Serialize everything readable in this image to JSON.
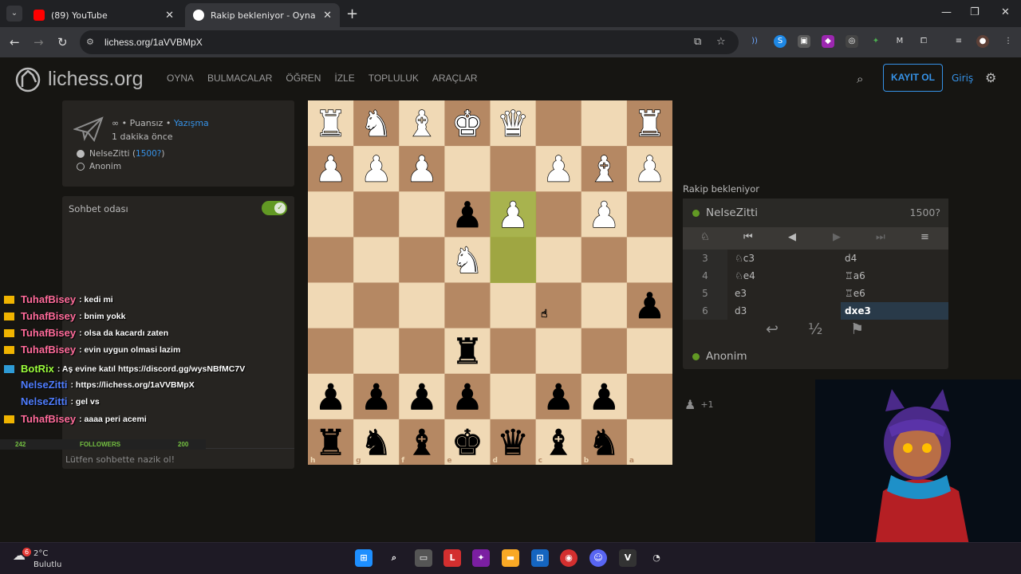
{
  "browser": {
    "tabs": [
      {
        "title": "(89) YouTube",
        "active": false
      },
      {
        "title": "Rakip bekleniyor - Oyna NelseZ",
        "active": true
      }
    ],
    "url": "lichess.org/1aVVBMpX"
  },
  "header": {
    "logo": "lichess.org",
    "nav": [
      "OYNA",
      "BULMACALAR",
      "ÖĞREN",
      "İZLE",
      "TOPLULUK",
      "ARAÇLAR"
    ],
    "signup": "KAYIT OL",
    "login": "Giriş"
  },
  "game_info": {
    "meta": "∞ • Puansız •",
    "mode": "Yazışma",
    "time_ago": "1 dakika önce",
    "player1_name": "NeIseZitti (",
    "player1_rating": "1500?",
    "player1_close": ")",
    "player2_name": "Anonim"
  },
  "chat": {
    "title": "Sohbet odası",
    "placeholder": "Lütfen sohbette nazik ol!"
  },
  "stream_chat": [
    {
      "user": "TuhafBisey",
      "text": ": kedi mi",
      "color": "#ff6b9a"
    },
    {
      "user": "TuhafBisey",
      "text": ": bnim yokk",
      "color": "#ff6b9a"
    },
    {
      "user": "TuhafBisey",
      "text": ": olsa da kacardı zaten",
      "color": "#ff6b9a"
    },
    {
      "user": "TuhafBisey",
      "text": ": evin uygun olmasi lazim",
      "color": "#ff6b9a"
    },
    {
      "user": "BotRix",
      "text": ": Aş evine katıl https://discord.gg/wysNBfMC7V",
      "color": "#9cff3c"
    },
    {
      "user": "NelseZitti",
      "text": ": https://lichess.org/1aVVBMpX",
      "color": "#4f7dff"
    },
    {
      "user": "NelseZitti",
      "text": ": gel vs",
      "color": "#4f7dff"
    },
    {
      "user": "TuhafBisey",
      "text": ": aaaa peri acemi",
      "color": "#ff6b9a"
    }
  ],
  "followers": {
    "current": "242",
    "label": "FOLLOWERS",
    "goal": "200"
  },
  "board": {
    "orientation": "black",
    "files_bottom": [
      "h",
      "g",
      "f",
      "e",
      "d",
      "c",
      "b",
      "a"
    ],
    "ranks_right": [
      "1",
      "2",
      "3",
      "4",
      "5",
      "6",
      "7",
      "8"
    ],
    "highlight_squares": [
      "d3",
      "d4"
    ],
    "pieces": [
      {
        "sq": "h1",
        "p": "wR"
      },
      {
        "sq": "g1",
        "p": "wN"
      },
      {
        "sq": "f1",
        "p": "wB"
      },
      {
        "sq": "e1",
        "p": "wK"
      },
      {
        "sq": "d1",
        "p": "wQ"
      },
      {
        "sq": "a1",
        "p": "wR"
      },
      {
        "sq": "h2",
        "p": "wP"
      },
      {
        "sq": "g2",
        "p": "wP"
      },
      {
        "sq": "f2",
        "p": "wP"
      },
      {
        "sq": "c2",
        "p": "wP"
      },
      {
        "sq": "b2",
        "p": "wB"
      },
      {
        "sq": "a2",
        "p": "wP"
      },
      {
        "sq": "e3",
        "p": "bP"
      },
      {
        "sq": "d3",
        "p": "wP"
      },
      {
        "sq": "b3",
        "p": "wP"
      },
      {
        "sq": "e4",
        "p": "wN"
      },
      {
        "sq": "a5",
        "p": "bP"
      },
      {
        "sq": "e6",
        "p": "bR"
      },
      {
        "sq": "h7",
        "p": "bP"
      },
      {
        "sq": "g7",
        "p": "bP"
      },
      {
        "sq": "f7",
        "p": "bP"
      },
      {
        "sq": "e7",
        "p": "bP"
      },
      {
        "sq": "c7",
        "p": "bP"
      },
      {
        "sq": "b7",
        "p": "bP"
      },
      {
        "sq": "h8",
        "p": "bR"
      },
      {
        "sq": "g8",
        "p": "bN"
      },
      {
        "sq": "f8",
        "p": "bB"
      },
      {
        "sq": "e8",
        "p": "bK"
      },
      {
        "sq": "d8",
        "p": "bQ"
      },
      {
        "sq": "c8",
        "p": "bB"
      },
      {
        "sq": "b8",
        "p": "bN"
      }
    ]
  },
  "right_panel": {
    "status": "Rakip bekleniyor",
    "top_player": "NeIseZitti",
    "top_rating": "1500?",
    "bottom_player": "Anonim",
    "moves": [
      {
        "n": "3",
        "w": "♘c3",
        "b": "d4"
      },
      {
        "n": "4",
        "w": "♘e4",
        "b": "♖a6"
      },
      {
        "n": "5",
        "w": "e3",
        "b": "♖e6"
      },
      {
        "n": "6",
        "w": "d3",
        "b": "dxe3"
      }
    ],
    "spectators": "+1"
  },
  "taskbar": {
    "temp": "2°C",
    "weather": "Bulutlu",
    "notif": "6"
  }
}
